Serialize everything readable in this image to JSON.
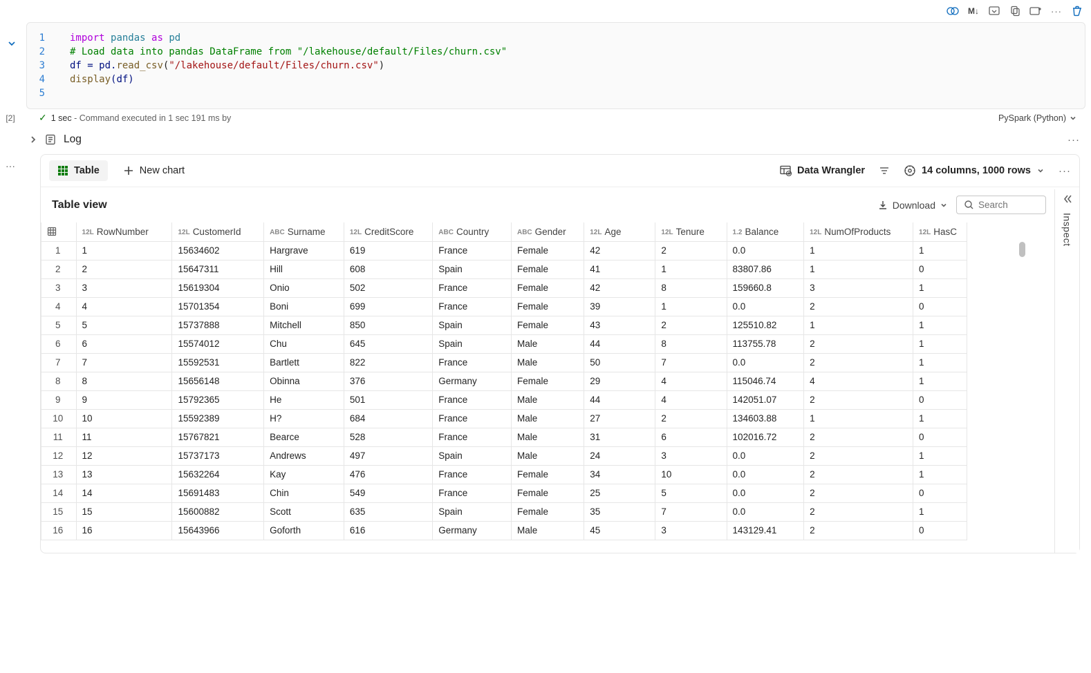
{
  "toolbar": {
    "markdown_label": "M↓"
  },
  "code": {
    "linenos": [
      "1",
      "2",
      "3",
      "4",
      "5"
    ],
    "line1_import": "import",
    "line1_mod1": "pandas",
    "line1_as": "as",
    "line1_mod2": "pd",
    "line2_comment": "# Load data into pandas DataFrame from \"/lakehouse/default/Files/churn.csv\"",
    "line3_pre": "df = pd.",
    "line3_fn": "read_csv",
    "line3_paren1": "(",
    "line3_str": "\"/lakehouse/default/Files/churn.csv\"",
    "line3_paren2": ")",
    "line4_fn": "display",
    "line4_arg": "(df)"
  },
  "status": {
    "exec_count": "[2]",
    "duration": "1 sec",
    "exec_text": " - Command executed in 1 sec 191 ms by",
    "kernel": "PySpark (Python)"
  },
  "log": {
    "label": "Log"
  },
  "output": {
    "table_btn": "Table",
    "new_chart": "New chart",
    "data_wrangler": "Data Wrangler",
    "colcount": "14 columns, 1000 rows",
    "table_view": "Table view",
    "download": "Download",
    "search_placeholder": "Search",
    "inspect": "Inspect"
  },
  "columns": [
    {
      "type": "",
      "label": "",
      "cls": "w-idx"
    },
    {
      "type": "12L",
      "label": "RowNumber",
      "cls": "w-r"
    },
    {
      "type": "12L",
      "label": "CustomerId",
      "cls": "w-c"
    },
    {
      "type": "ABC",
      "label": "Surname",
      "cls": "w-s"
    },
    {
      "type": "12L",
      "label": "CreditScore",
      "cls": "w-cr"
    },
    {
      "type": "ABC",
      "label": "Country",
      "cls": "w-co"
    },
    {
      "type": "ABC",
      "label": "Gender",
      "cls": "w-g"
    },
    {
      "type": "12L",
      "label": "Age",
      "cls": "w-a"
    },
    {
      "type": "12L",
      "label": "Tenure",
      "cls": "w-t"
    },
    {
      "type": "1.2",
      "label": "Balance",
      "cls": "w-b"
    },
    {
      "type": "12L",
      "label": "NumOfProducts",
      "cls": "w-n"
    },
    {
      "type": "12L",
      "label": "HasC",
      "cls": "w-h"
    }
  ],
  "rows": [
    [
      "1",
      "1",
      "15634602",
      "Hargrave",
      "619",
      "France",
      "Female",
      "42",
      "2",
      "0.0",
      "1",
      "1"
    ],
    [
      "2",
      "2",
      "15647311",
      "Hill",
      "608",
      "Spain",
      "Female",
      "41",
      "1",
      "83807.86",
      "1",
      "0"
    ],
    [
      "3",
      "3",
      "15619304",
      "Onio",
      "502",
      "France",
      "Female",
      "42",
      "8",
      "159660.8",
      "3",
      "1"
    ],
    [
      "4",
      "4",
      "15701354",
      "Boni",
      "699",
      "France",
      "Female",
      "39",
      "1",
      "0.0",
      "2",
      "0"
    ],
    [
      "5",
      "5",
      "15737888",
      "Mitchell",
      "850",
      "Spain",
      "Female",
      "43",
      "2",
      "125510.82",
      "1",
      "1"
    ],
    [
      "6",
      "6",
      "15574012",
      "Chu",
      "645",
      "Spain",
      "Male",
      "44",
      "8",
      "113755.78",
      "2",
      "1"
    ],
    [
      "7",
      "7",
      "15592531",
      "Bartlett",
      "822",
      "France",
      "Male",
      "50",
      "7",
      "0.0",
      "2",
      "1"
    ],
    [
      "8",
      "8",
      "15656148",
      "Obinna",
      "376",
      "Germany",
      "Female",
      "29",
      "4",
      "115046.74",
      "4",
      "1"
    ],
    [
      "9",
      "9",
      "15792365",
      "He",
      "501",
      "France",
      "Male",
      "44",
      "4",
      "142051.07",
      "2",
      "0"
    ],
    [
      "10",
      "10",
      "15592389",
      "H?",
      "684",
      "France",
      "Male",
      "27",
      "2",
      "134603.88",
      "1",
      "1"
    ],
    [
      "11",
      "11",
      "15767821",
      "Bearce",
      "528",
      "France",
      "Male",
      "31",
      "6",
      "102016.72",
      "2",
      "0"
    ],
    [
      "12",
      "12",
      "15737173",
      "Andrews",
      "497",
      "Spain",
      "Male",
      "24",
      "3",
      "0.0",
      "2",
      "1"
    ],
    [
      "13",
      "13",
      "15632264",
      "Kay",
      "476",
      "France",
      "Female",
      "34",
      "10",
      "0.0",
      "2",
      "1"
    ],
    [
      "14",
      "14",
      "15691483",
      "Chin",
      "549",
      "France",
      "Female",
      "25",
      "5",
      "0.0",
      "2",
      "0"
    ],
    [
      "15",
      "15",
      "15600882",
      "Scott",
      "635",
      "Spain",
      "Female",
      "35",
      "7",
      "0.0",
      "2",
      "1"
    ],
    [
      "16",
      "16",
      "15643966",
      "Goforth",
      "616",
      "Germany",
      "Male",
      "45",
      "3",
      "143129.41",
      "2",
      "0"
    ]
  ]
}
